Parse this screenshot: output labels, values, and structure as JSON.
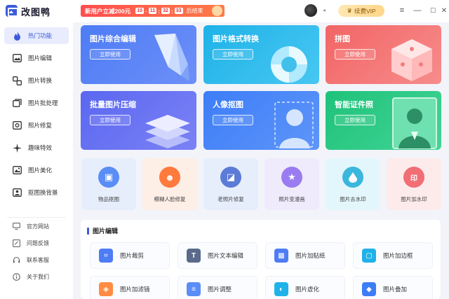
{
  "app": {
    "name": "改图鸭"
  },
  "promo": {
    "text": "新用户立减200元",
    "countdown": [
      "10",
      "11",
      "32",
      "33"
    ],
    "suffix": "后结束"
  },
  "header": {
    "vip_label": "续费VIP",
    "avatar_caret": "◂"
  },
  "window_controls": {
    "menu": "≡",
    "minimize": "—",
    "maximize": "☐",
    "close": "✕"
  },
  "sidebar": {
    "items": [
      {
        "label": "热门功能",
        "icon": "flame-icon",
        "glyph": "🔥",
        "active": true
      },
      {
        "label": "图片编辑",
        "icon": "image-edit-icon",
        "glyph": "🖉"
      },
      {
        "label": "图片转换",
        "icon": "convert-icon",
        "glyph": "⇆"
      },
      {
        "label": "图片批处理",
        "icon": "batch-icon",
        "glyph": "▦"
      },
      {
        "label": "照片修复",
        "icon": "repair-icon",
        "glyph": "◧"
      },
      {
        "label": "趣味特效",
        "icon": "sparkle-icon",
        "glyph": "✲"
      },
      {
        "label": "图片美化",
        "icon": "beautify-icon",
        "glyph": "◩"
      },
      {
        "label": "抠图换背景",
        "icon": "cutout-icon",
        "glyph": "⬚"
      }
    ],
    "footer": [
      {
        "label": "官方网站",
        "icon": "monitor-icon",
        "glyph": "▭"
      },
      {
        "label": "问题反馈",
        "icon": "feedback-icon",
        "glyph": "✎"
      },
      {
        "label": "联系客服",
        "icon": "headset-icon",
        "glyph": "☊"
      },
      {
        "label": "关于我们",
        "icon": "info-icon",
        "glyph": "ⓘ"
      }
    ]
  },
  "feature_cards": [
    {
      "title": "图片综合编辑",
      "action": "立即使用",
      "color": "#4d7cf5"
    },
    {
      "title": "图片格式转换",
      "action": "立即使用",
      "color": "#1fb2e8"
    },
    {
      "title": "拼图",
      "action": "立即使用",
      "color": "#f26565"
    },
    {
      "title": "批量图片压缩",
      "action": "立即使用",
      "color": "#5a67f0"
    },
    {
      "title": "人像抠图",
      "action": "立即使用",
      "color": "#3d7df7"
    },
    {
      "title": "智能证件照",
      "action": "立即使用",
      "color": "#1fc27a"
    }
  ],
  "tools_row": [
    {
      "label": "物品抠图",
      "icon": "box-icon",
      "glyph": "▣",
      "bg": "#e6eefc",
      "icon_color": "#5a8df5"
    },
    {
      "label": "模糊人脸修复",
      "icon": "face-icon",
      "glyph": "☻",
      "bg": "#fdeee6",
      "icon_color": "#ff7a3d"
    },
    {
      "label": "老照片修复",
      "icon": "photo-icon",
      "glyph": "◪",
      "bg": "#e6eefc",
      "icon_color": "#5b7bd6"
    },
    {
      "label": "照片变漫画",
      "icon": "comic-icon",
      "glyph": "★",
      "bg": "#efebfc",
      "icon_color": "#9a7cf0"
    },
    {
      "label": "图片去水印",
      "icon": "drop-icon",
      "glyph": "💧",
      "bg": "#e3f6fb",
      "icon_color": "#3bb7dd"
    },
    {
      "label": "图片加水印",
      "icon": "stamp-icon",
      "glyph": "印",
      "bg": "#fdebec",
      "icon_color": "#f06e74"
    }
  ],
  "section": {
    "title": "图片编辑",
    "tools": [
      {
        "label": "图片裁剪",
        "icon": "crop-icon",
        "glyph": "⌗",
        "color": "#4d7cf5"
      },
      {
        "label": "图片文本编辑",
        "icon": "text-icon",
        "glyph": "T",
        "color": "#5a6a8a"
      },
      {
        "label": "图片加贴纸",
        "icon": "sticker-icon",
        "glyph": "▩",
        "color": "#4d7cf5"
      },
      {
        "label": "图片加边框",
        "icon": "frame-icon",
        "glyph": "▢",
        "color": "#1fb2e8"
      },
      {
        "label": "图片加滤镜",
        "icon": "filter-icon",
        "glyph": "◈",
        "color": "#ff8c42"
      },
      {
        "label": "图片调整",
        "icon": "adjust-icon",
        "glyph": "≡",
        "color": "#5a8df5"
      },
      {
        "label": "图片虚化",
        "icon": "blur-icon",
        "glyph": "◐",
        "color": "#1fb2e8"
      },
      {
        "label": "图片叠加",
        "icon": "layers-icon",
        "glyph": "◆",
        "color": "#3d7df7"
      }
    ]
  }
}
